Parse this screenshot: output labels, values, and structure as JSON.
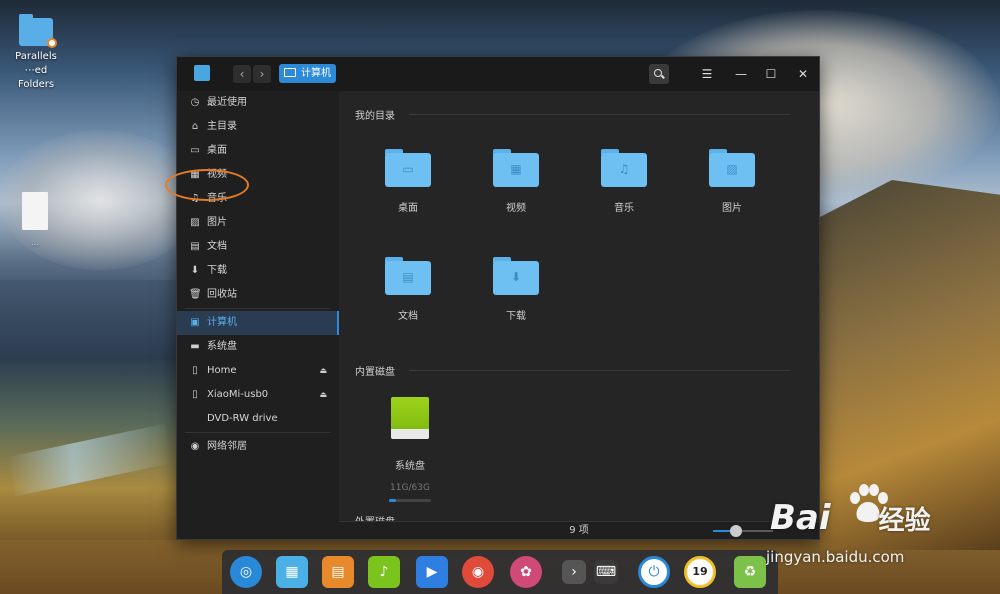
{
  "desktop": {
    "folder_label_line1": "Parallels",
    "folder_label_line2": "⋯ed Folders",
    "doc_label": "…"
  },
  "window": {
    "breadcrumb": "计算机",
    "back_glyph": "‹",
    "forward_glyph": "›",
    "menu_glyph": "☰",
    "minimize_glyph": "—",
    "maximize_glyph": "☐",
    "close_glyph": "✕"
  },
  "sidebar": {
    "items": [
      {
        "label": "最近使用",
        "icon": "clock-icon"
      },
      {
        "label": "主目录",
        "icon": "home-icon"
      },
      {
        "label": "桌面",
        "icon": "desktop-icon"
      },
      {
        "label": "视频",
        "icon": "film-icon"
      },
      {
        "label": "音乐",
        "icon": "music-icon"
      },
      {
        "label": "图片",
        "icon": "picture-icon"
      },
      {
        "label": "文档",
        "icon": "document-icon"
      },
      {
        "label": "下载",
        "icon": "download-icon"
      },
      {
        "label": "回收站",
        "icon": "trash-icon"
      },
      {
        "label": "计算机",
        "icon": "computer-icon",
        "active": true
      },
      {
        "label": "系统盘",
        "icon": "disk-icon"
      },
      {
        "label": "Home",
        "icon": "drive-icon",
        "eject": true
      },
      {
        "label": "XiaoMi-usb0",
        "icon": "drive-icon",
        "eject": true
      },
      {
        "label": "DVD-RW drive",
        "icon": "none"
      },
      {
        "label": "网络邻居",
        "icon": "network-icon"
      }
    ]
  },
  "main": {
    "my_dirs_title": "我的目录",
    "folders": [
      {
        "label": "桌面",
        "icon": "desktop-folder-icon",
        "glyph": "▭"
      },
      {
        "label": "视频",
        "icon": "video-folder-icon",
        "glyph": "▦"
      },
      {
        "label": "音乐",
        "icon": "music-folder-icon",
        "glyph": "♫"
      },
      {
        "label": "图片",
        "icon": "picture-folder-icon",
        "glyph": "▨"
      },
      {
        "label": "文档",
        "icon": "document-folder-icon",
        "glyph": "▤"
      },
      {
        "label": "下载",
        "icon": "download-folder-icon",
        "glyph": "⬇"
      }
    ],
    "internal_disks_title": "内置磁盘",
    "disk": {
      "label": "系统盘",
      "usage": "11G/63G",
      "used_fraction": 0.17
    },
    "external_disks_title": "外置磁盘"
  },
  "status": {
    "item_count": "9 项",
    "zoom_level": 0.38
  },
  "dock": {
    "apps": [
      {
        "name": "launcher-icon",
        "color": "#2a88d8"
      },
      {
        "name": "file-manager-icon",
        "color": "#4ab0e6"
      },
      {
        "name": "app-store-icon",
        "color": "#e8892b"
      },
      {
        "name": "music-player-icon",
        "color": "#7bc41e"
      },
      {
        "name": "video-player-icon",
        "color": "#2e7fe0"
      },
      {
        "name": "chrome-icon",
        "color": "#e04a3a"
      },
      {
        "name": "settings-icon",
        "color": "#d04a78"
      },
      {
        "name": "expand-tray-icon",
        "color": "#555555"
      },
      {
        "name": "keyboard-icon",
        "color": "#3a3a3a"
      },
      {
        "name": "power-icon",
        "color": "#2a88d8"
      },
      {
        "name": "clock-widget-icon",
        "color": "#f2c02a"
      },
      {
        "name": "trash-icon",
        "color": "#7cc24a"
      }
    ],
    "clock_widget_text": "19"
  },
  "watermark": {
    "brand": "Bai",
    "brand_suffix": "经验",
    "url": "jingyan.baidu.com"
  }
}
